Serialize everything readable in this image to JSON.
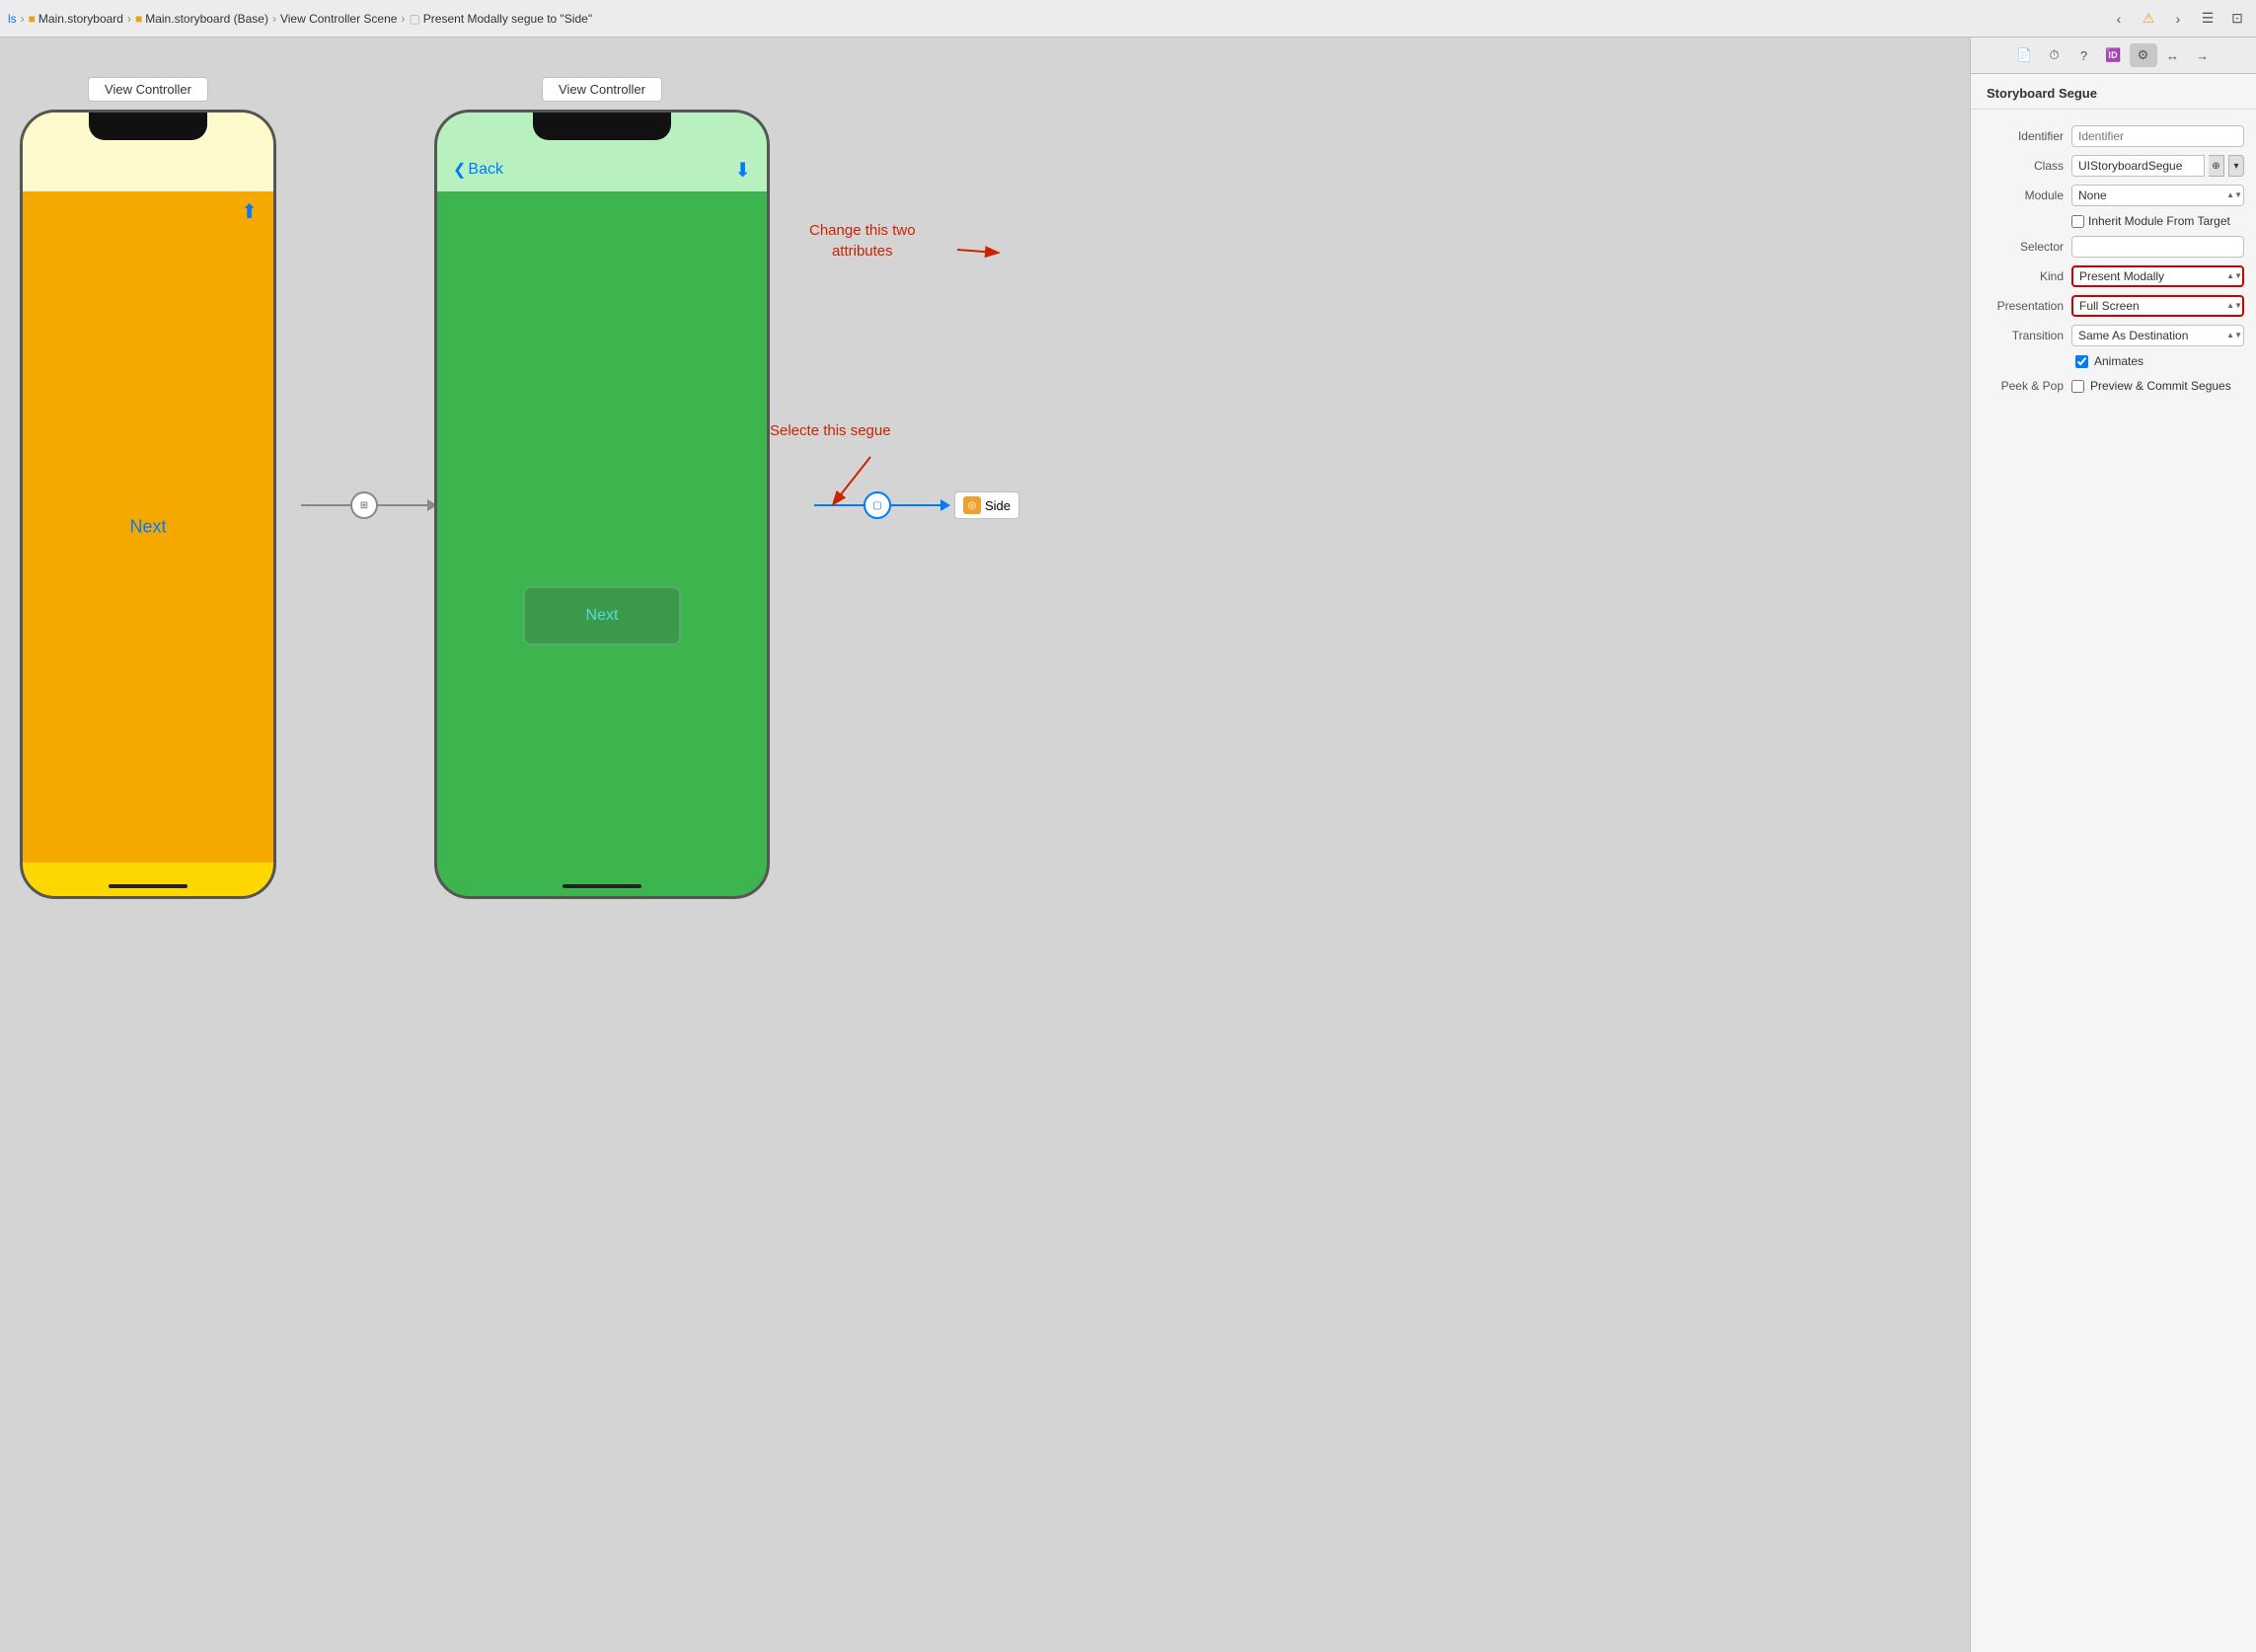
{
  "toolbar": {
    "breadcrumbs": [
      "ls",
      "Main.storyboard",
      "Main.storyboard (Base)",
      "View Controller Scene",
      "Present Modally segue to \"Side\""
    ],
    "nav_back": "‹",
    "nav_forward": "›",
    "warning_icon": "⚠",
    "grid_icon": "☰",
    "fullscreen_icon": "⊡"
  },
  "canvas": {
    "left_vc": {
      "label": "View Controller",
      "next_label": "Next"
    },
    "right_vc": {
      "label": "View Controller",
      "back_label": "Back",
      "next_label": "Next"
    },
    "annotation1": {
      "text": "Change this two\nattributes"
    },
    "annotation2": {
      "text": "Selecte this segue"
    },
    "segue_side_label": "Side"
  },
  "inspector": {
    "title": "Storyboard Segue",
    "tabs": [
      "file-icon",
      "history-icon",
      "help-icon",
      "id-icon",
      "attr-icon",
      "size-icon",
      "connection-icon"
    ],
    "rows": {
      "identifier_label": "Identifier",
      "identifier_placeholder": "Identifier",
      "class_label": "Class",
      "class_value": "UIStoryboardSegue",
      "module_label": "Module",
      "module_value": "None",
      "inherit_label": "",
      "inherit_check_label": "Inherit Module From Target",
      "selector_label": "Selector",
      "selector_value": "",
      "kind_label": "Kind",
      "kind_value": "Present Modally",
      "presentation_label": "Presentation",
      "presentation_value": "Full Screen",
      "transition_label": "Transition",
      "transition_value": "Same As Destination",
      "animates_label": "",
      "animates_check_label": "Animates",
      "peek_pop_label": "Peek & Pop",
      "peek_pop_check_label": "Preview & Commit Segues"
    }
  }
}
